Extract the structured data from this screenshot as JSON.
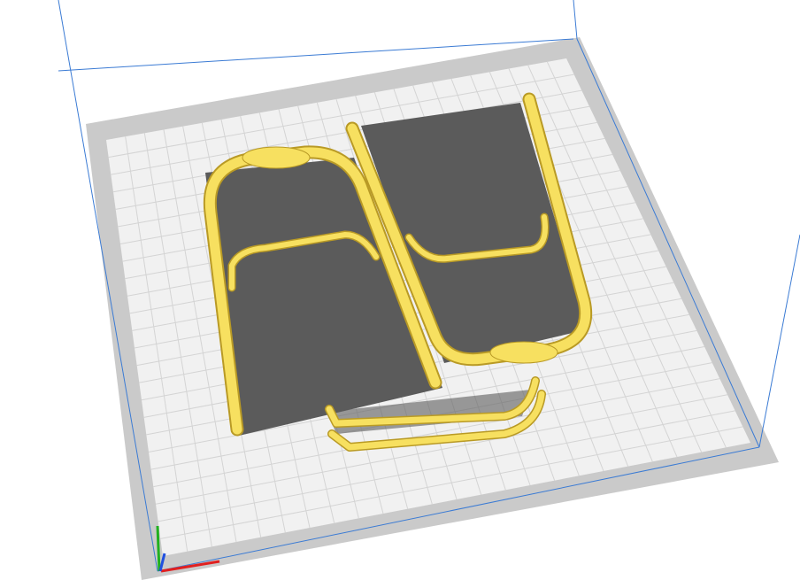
{
  "viewport": {
    "colors": {
      "background": "#ffffff",
      "plate_border": "#c9c9c9",
      "plate_surface": "#f2f2f2",
      "grid_line": "#d6d6d6",
      "volume_line": "#3b7bd4",
      "shadow": "#5a5a5a",
      "model_fill": "#f7e060",
      "model_edge": "#c9a92a",
      "axis_x": "#e02020",
      "axis_y": "#20b020",
      "axis_z": "#2050e0"
    }
  }
}
